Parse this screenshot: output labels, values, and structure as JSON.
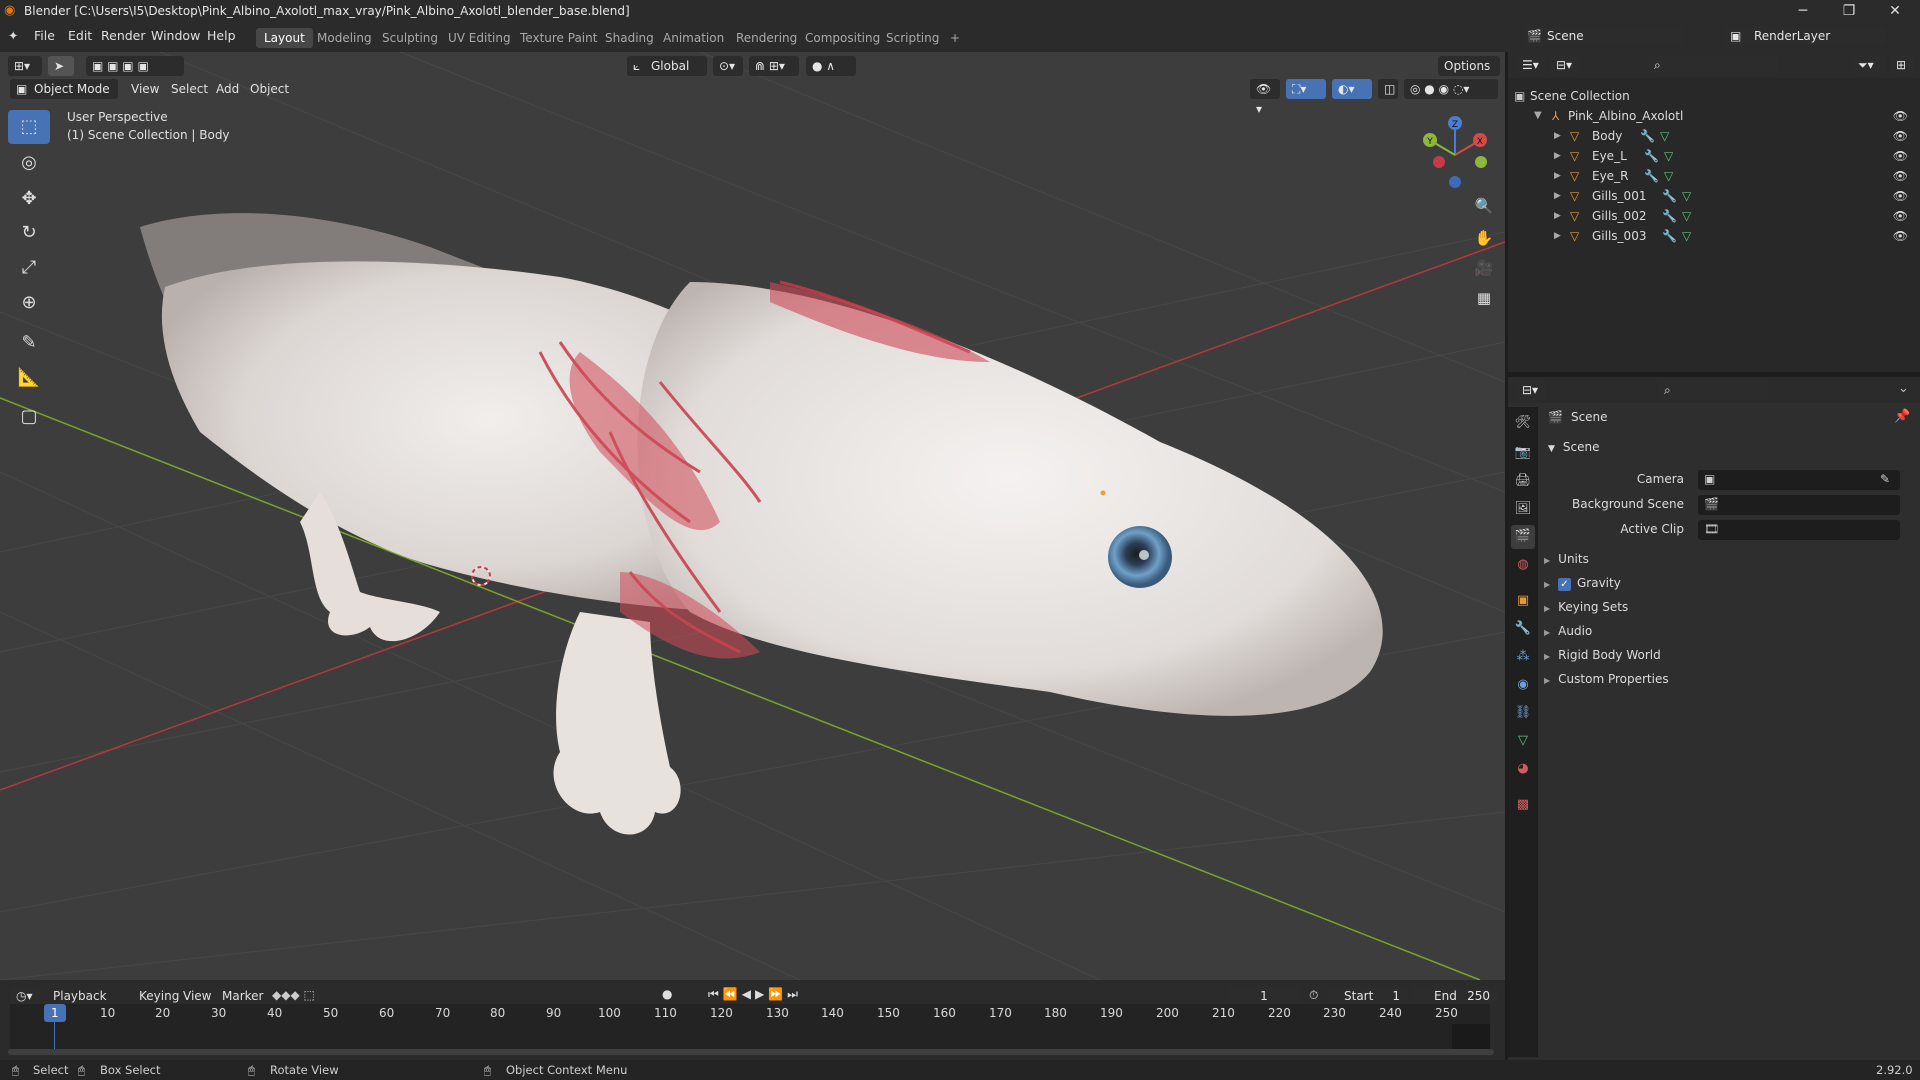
{
  "titlebar": {
    "title": "Blender [C:\\Users\\I5\\Desktop\\Pink_Albino_Axolotl_max_vray/Pink_Albino_Axolotl_blender_base.blend]",
    "min": "─",
    "max": "❐",
    "close": "✕"
  },
  "menubar": {
    "items": [
      "File",
      "Edit",
      "Render",
      "Window",
      "Help"
    ],
    "workspaces": [
      "Layout",
      "Modeling",
      "Sculpting",
      "UV Editing",
      "Texture Paint",
      "Shading",
      "Animation",
      "Rendering",
      "Compositing",
      "Scripting"
    ],
    "add_tab": "+",
    "scene_label": "Scene",
    "render_layer": "RenderLayer"
  },
  "viewport": {
    "orientation": "Global",
    "options": "Options",
    "mode": "Object Mode",
    "menus": [
      "View",
      "Select",
      "Add",
      "Object"
    ],
    "overlay_title": "User Perspective",
    "overlay_subtitle": "(1) Scene Collection | Body",
    "gizmo": {
      "x": "X",
      "y": "Y",
      "z": "Z"
    },
    "colors": {
      "bg": "#3d3d3d",
      "x_axis": "#b5383f",
      "y_axis": "#7ba42a",
      "active_tool": "#4772b3"
    }
  },
  "outliner": {
    "root": "Scene Collection",
    "collection": "Pink_Albino_Axolotl",
    "objects": [
      "Body",
      "Eye_L",
      "Eye_R",
      "Gills_001",
      "Gills_002",
      "Gills_003"
    ]
  },
  "properties": {
    "header": "Scene",
    "section": "Scene",
    "fields": [
      {
        "label": "Camera"
      },
      {
        "label": "Background Scene"
      },
      {
        "label": "Active Clip"
      }
    ],
    "panels": [
      "Units",
      "Gravity",
      "Keying Sets",
      "Audio",
      "Rigid Body World",
      "Custom Properties"
    ],
    "gravity_checked": true
  },
  "timeline": {
    "menus": [
      "Playback",
      "Keying",
      "View",
      "Marker"
    ],
    "current_frame": "1",
    "start_label": "Start",
    "start": "1",
    "end_label": "End",
    "end": "250",
    "ticks": [
      "1",
      "10",
      "20",
      "30",
      "40",
      "50",
      "60",
      "70",
      "80",
      "90",
      "100",
      "110",
      "120",
      "130",
      "140",
      "150",
      "160",
      "170",
      "180",
      "190",
      "200",
      "210",
      "220",
      "230",
      "240",
      "250"
    ]
  },
  "statusbar": {
    "select": "Select",
    "box_select": "Box Select",
    "rotate": "Rotate View",
    "context": "Object Context Menu",
    "version": "2.92.0"
  }
}
